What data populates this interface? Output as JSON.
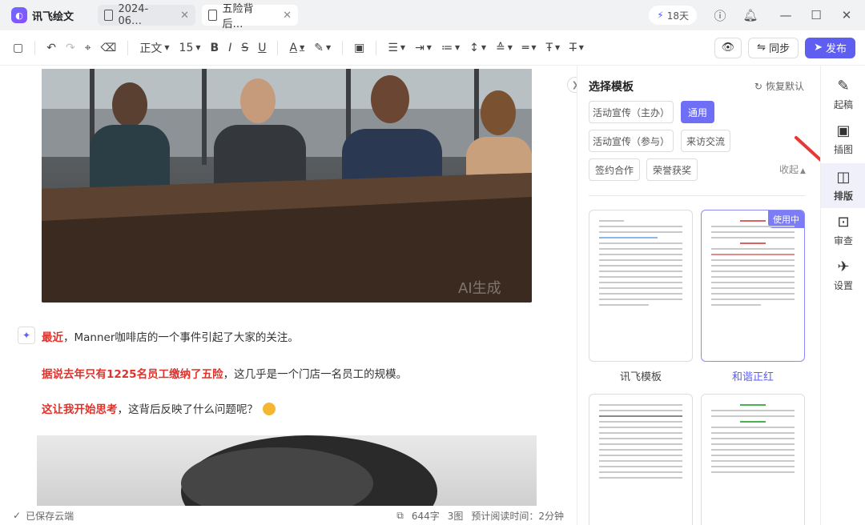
{
  "app": {
    "name": "讯飞绘文"
  },
  "tabs": [
    {
      "label": "2024-06…"
    },
    {
      "label": "五险背后…"
    }
  ],
  "topbar": {
    "days": "18天"
  },
  "toolbar": {
    "style": "正文",
    "size": "15",
    "sync": "同步",
    "publish": "发布"
  },
  "editor": {
    "p1": {
      "red": "最近",
      "rest": "，Manner咖啡店的一个事件引起了大家的关注。"
    },
    "p2": {
      "red": "据说去年只有1225名员工缴纳了五险",
      "rest": "，这几乎是一个门店一名员工的规模。"
    },
    "p3": {
      "red": "这让我开始思考",
      "rest": "，这背后反映了什么问题呢？"
    },
    "watermark": "AI生成"
  },
  "status": {
    "saved": "已保存云端",
    "words": "644字",
    "images": "3图",
    "read": "预计阅读时间：2分钟"
  },
  "panel": {
    "title": "选择模板",
    "restore": "恢复默认",
    "chips": [
      "活动宣传（主办）",
      "通用",
      "活动宣传（参与）",
      "来访交流",
      "签约合作",
      "荣誉获奖"
    ],
    "collapse": "收起",
    "cards": [
      {
        "label": "讯飞模板"
      },
      {
        "label": "和谐正红",
        "tag": "使用中"
      }
    ]
  },
  "sidebar": {
    "items": [
      "起稿",
      "插图",
      "排版",
      "审查",
      "设置"
    ]
  }
}
